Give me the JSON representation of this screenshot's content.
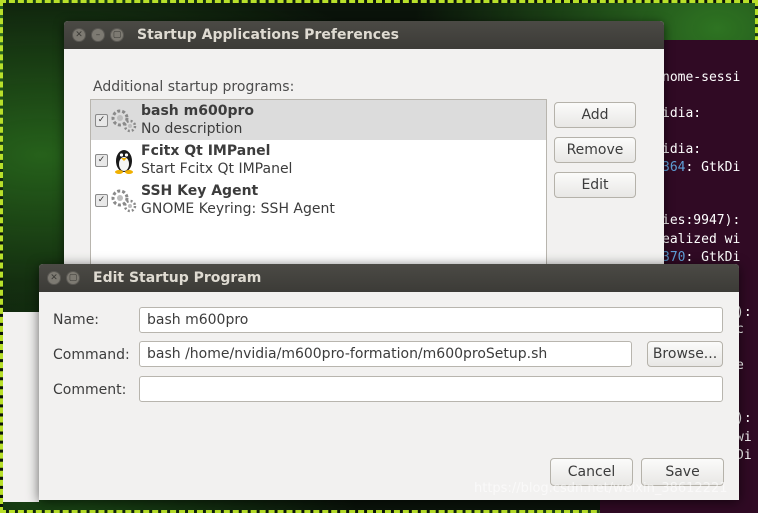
{
  "terminal": {
    "lines": [
      {
        "text": "nome-sessi",
        "style": "normal"
      },
      {
        "text": "idia:",
        "style": "normal"
      },
      {
        "text": "idia:",
        "style": "normal"
      },
      {
        "text": "364: GtkDi",
        "style": "blue-prefix"
      },
      {
        "text": "ies:9947):",
        "style": "normal"
      },
      {
        "text": "ealized wi",
        "style": "normal"
      },
      {
        "text": "370: GtkDi",
        "style": "blue-prefix"
      }
    ]
  },
  "startup_window": {
    "title": "Startup Applications Preferences",
    "section_label": "Additional startup programs:",
    "programs": [
      {
        "name": "bash m600pro",
        "description": "No description",
        "checked": true,
        "icon": "gears-icon",
        "selected": true
      },
      {
        "name": "Fcitx Qt IMPanel",
        "description": "Start Fcitx Qt IMPanel",
        "checked": true,
        "icon": "tux-penguin-icon",
        "selected": false
      },
      {
        "name": "SSH Key Agent",
        "description": "GNOME Keyring: SSH Agent",
        "checked": true,
        "icon": "gears-icon",
        "selected": false
      }
    ],
    "buttons": {
      "add": "Add",
      "remove": "Remove",
      "edit": "Edit"
    }
  },
  "edit_dialog": {
    "title": "Edit Startup Program",
    "name_label": "Name:",
    "name_value": "bash m600pro",
    "command_label": "Command:",
    "command_value": "bash /home/nvidia/m600pro-formation/m600proSetup.sh",
    "browse_label": "Browse...",
    "comment_label": "Comment:",
    "comment_value": "",
    "cancel_label": "Cancel",
    "save_label": "Save"
  },
  "watermark": "https://blog.csdn.net/weixin_38612221",
  "colors": {
    "terminal_bg": "#300a24",
    "titlebar": "#3c3b37",
    "window_bg": "#f2f1f0",
    "desktop_border": "#b8e02a"
  }
}
